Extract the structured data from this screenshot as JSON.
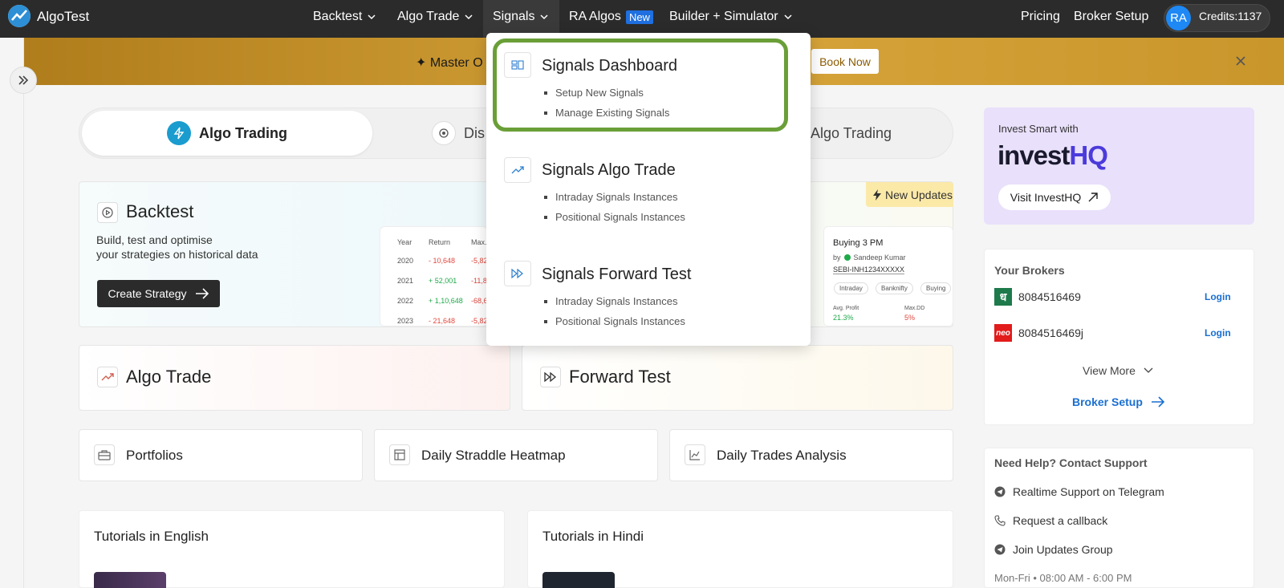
{
  "nav": {
    "brand": "AlgoTest",
    "items": [
      {
        "label": "Backtest"
      },
      {
        "label": "Algo Trade"
      },
      {
        "label": "Signals"
      },
      {
        "label": "RA Algos",
        "badge": "New"
      },
      {
        "label": "Builder + Simulator"
      }
    ],
    "pricing": "Pricing",
    "broker_setup": "Broker Setup",
    "avatar": "RA",
    "credits": "Credits:1137"
  },
  "banner": {
    "text": "✦  Master O",
    "button": "Book Now"
  },
  "tabs": {
    "active": "Algo Trading",
    "second": "Dis",
    "third": "Algo Trading"
  },
  "backtest_card": {
    "title": "Backtest",
    "desc_line1": "Build, test and optimise",
    "desc_line2": "your strategies on historical data",
    "button": "Create Strategy",
    "new_updates": "New Updates",
    "table": {
      "headers": [
        "Year",
        "Return",
        "Max."
      ],
      "rows": [
        [
          "2020",
          "- 10,648",
          "-5,82"
        ],
        [
          "2021",
          "+ 52,001",
          "-11,8"
        ],
        [
          "2022",
          "+ 1,10,648",
          "-68,6"
        ],
        [
          "2023",
          "- 21,648",
          "-5,82"
        ]
      ]
    },
    "signal_preview": {
      "title": "Buying 3 PM",
      "by": "by",
      "author": "Sandeep Kumar",
      "sebi": "SEBI-INH1234XXXXX",
      "tags": [
        "Intraday",
        "Banknifty",
        "Buying"
      ],
      "stat1_label": "Avg. Profit",
      "stat1_value": "21.3%",
      "stat2_label": "Max.DD",
      "stat2_value": "5%"
    }
  },
  "cards": {
    "algo_trade": "Algo Trade",
    "forward_test": "Forward Test",
    "portfolios": "Portfolios",
    "heatmap": "Daily Straddle Heatmap",
    "trades_analysis": "Daily Trades Analysis",
    "tut_en": "Tutorials in English",
    "tut_hi": "Tutorials in Hindi"
  },
  "invest": {
    "small": "Invest Smart with",
    "logo_a": "invest",
    "logo_b": "HQ",
    "button": "Visit InvestHQ"
  },
  "brokers": {
    "title": "Your Brokers",
    "list": [
      {
        "logo": "ध",
        "number": "8084516469",
        "login": "Login"
      },
      {
        "logo": "neo",
        "number": "8084516469j",
        "login": "Login"
      }
    ],
    "view_more": "View More",
    "setup": "Broker Setup"
  },
  "help": {
    "title": "Need Help? Contact Support",
    "items": [
      "Realtime Support on Telegram",
      "Request a callback",
      "Join Updates Group"
    ],
    "hours": "Mon-Fri • 08:00 AM - 6:00 PM"
  },
  "dropdown": {
    "sections": [
      {
        "title": "Signals Dashboard",
        "subs": [
          "Setup New Signals",
          "Manage Existing Signals"
        ]
      },
      {
        "title": "Signals Algo Trade",
        "subs": [
          "Intraday Signals Instances",
          "Positional Signals Instances"
        ]
      },
      {
        "title": "Signals Forward Test",
        "subs": [
          "Intraday Signals Instances",
          "Positional Signals Instances"
        ]
      }
    ]
  },
  "colors": {
    "nav_bg": "#2b2b2b",
    "accent_blue": "#1a6fd1",
    "highlight_green": "#6a9f38",
    "banner_gold": "#d6a43a",
    "positive": "#1faa4a",
    "negative": "#e0483e"
  }
}
